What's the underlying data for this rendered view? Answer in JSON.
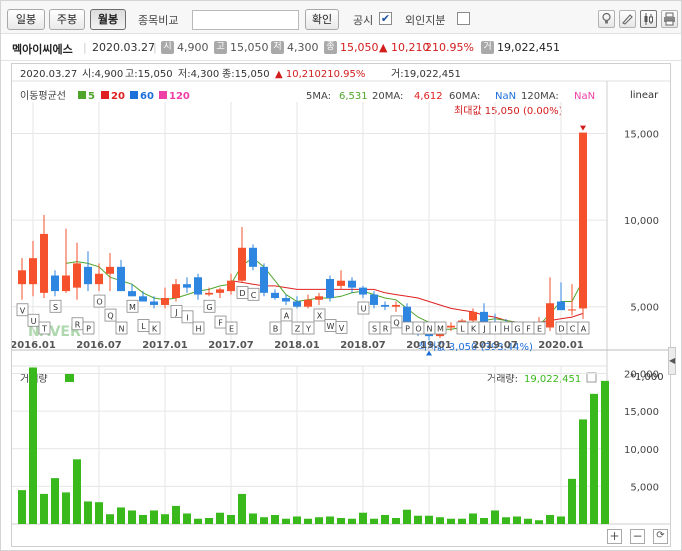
{
  "toolbar": {
    "period_buttons": [
      "일봉",
      "주봉",
      "월봉"
    ],
    "active_period": "월봉",
    "compare_label": "종목비교",
    "search_placeholder": "",
    "confirm_label": "확인",
    "disclosure_label": "공시",
    "disclosure_checked": "✔",
    "foreign_label": "외인지분",
    "icons": [
      "bulb-icon",
      "pen-icon",
      "candle-toggle-icon",
      "print-icon"
    ]
  },
  "info": {
    "name": "멕아이씨에스",
    "date": "2020.03.27",
    "open_badge": "시",
    "open": "4,900",
    "high_badge": "고",
    "high": "15,050",
    "low_badge": "저",
    "low": "4,300",
    "close_badge": "종",
    "close": "15,050",
    "change": "▲ 10,210",
    "change_pct": "210.95%",
    "volume_badge": "거",
    "volume": "19,022,451"
  },
  "chart_header": {
    "ohlc_line_date": "2020.03.27",
    "ohlc_line_open": "시:4,900",
    "ohlc_line_high": "고:15,050",
    "ohlc_line_low": "저:4,300",
    "ohlc_line_close": "종:15,050",
    "ohlc_line_change": "▲  10,210210.95%",
    "ohlc_line_volume": "거:19,022,451",
    "ma_label": "이동평균선",
    "ma_legend": [
      {
        "period": "5",
        "color": "#4fa52c"
      },
      {
        "period": "20",
        "color": "#e02020"
      },
      {
        "period": "60",
        "color": "#1e6fd9"
      },
      {
        "period": "120",
        "color": "#ee3fa7"
      }
    ],
    "ma_values": {
      "ma5_label": "5MA:",
      "ma5": "6,531",
      "ma20_label": "20MA:",
      "ma20": "4,612",
      "ma60_label": "60MA:",
      "ma60": "NaN",
      "ma120_label": "120MA:",
      "ma120": "NaN"
    },
    "scale_label": "linear",
    "max_label": "최대값 15,050 (0.00%)",
    "min_label": "최저값 3,050 (393.44%)",
    "watermark": "NAVER",
    "volume_title": "거래량",
    "volume_readout_label": "거래량:",
    "volume_readout_value": "19,022,451",
    "volume_unit": "*1,000"
  },
  "colors": {
    "up": "#f4512c",
    "down": "#2f86e0",
    "volume": "#39b91c",
    "ma5": "#4fa52c",
    "ma20": "#e02020",
    "grid": "#e6e6e6"
  },
  "chart_data": [
    {
      "type": "candlestick",
      "title": "",
      "x_tick_labels": [
        "2016.01",
        "2016.07",
        "2017.01",
        "2017.07",
        "2018.01",
        "2018.07",
        "2019.01",
        "2019.07",
        "2020.01"
      ],
      "y_tick_labels": [
        "5,000",
        "10,000",
        "15,000"
      ],
      "ylim": [
        2500,
        16700
      ],
      "grid": true,
      "period": "monthly",
      "candles": [
        {
          "month": "2015-12",
          "open": 6300,
          "high": 7800,
          "low": 5400,
          "close": 7100
        },
        {
          "month": "2016-01",
          "open": 6300,
          "high": 8800,
          "low": 5600,
          "close": 7800
        },
        {
          "month": "2016-02",
          "open": 5800,
          "high": 10300,
          "low": 5500,
          "close": 9200
        },
        {
          "month": "2016-03",
          "open": 6800,
          "high": 7100,
          "low": 5600,
          "close": 5900
        },
        {
          "month": "2016-04",
          "open": 5900,
          "high": 9500,
          "low": 5800,
          "close": 6800
        },
        {
          "month": "2016-05",
          "open": 6100,
          "high": 8700,
          "low": 5400,
          "close": 7500
        },
        {
          "month": "2016-06",
          "open": 7300,
          "high": 8200,
          "low": 5900,
          "close": 6300
        },
        {
          "month": "2016-07",
          "open": 6300,
          "high": 7500,
          "low": 5900,
          "close": 6900
        },
        {
          "month": "2016-08",
          "open": 6900,
          "high": 8100,
          "low": 5900,
          "close": 7300
        },
        {
          "month": "2016-09",
          "open": 7300,
          "high": 7700,
          "low": 5900,
          "close": 5900
        },
        {
          "month": "2016-10",
          "open": 5900,
          "high": 6300,
          "low": 5600,
          "close": 5600
        },
        {
          "month": "2016-11",
          "open": 5600,
          "high": 5900,
          "low": 5300,
          "close": 5300
        },
        {
          "month": "2016-12",
          "open": 5300,
          "high": 5600,
          "low": 4900,
          "close": 5100
        },
        {
          "month": "2017-01",
          "open": 5100,
          "high": 6100,
          "low": 4900,
          "close": 5500
        },
        {
          "month": "2017-02",
          "open": 5500,
          "high": 6600,
          "low": 5300,
          "close": 6300
        },
        {
          "month": "2017-03",
          "open": 6300,
          "high": 6700,
          "low": 5800,
          "close": 6100
        },
        {
          "month": "2017-04",
          "open": 6700,
          "high": 6900,
          "low": 5400,
          "close": 5700
        },
        {
          "month": "2017-05",
          "open": 5700,
          "high": 6100,
          "low": 5600,
          "close": 5800
        },
        {
          "month": "2017-06",
          "open": 5800,
          "high": 6100,
          "low": 5500,
          "close": 6000
        },
        {
          "month": "2017-07",
          "open": 5900,
          "high": 6900,
          "low": 5700,
          "close": 6500
        },
        {
          "month": "2017-08",
          "open": 6500,
          "high": 9600,
          "low": 6400,
          "close": 8400
        },
        {
          "month": "2017-09",
          "open": 8400,
          "high": 8600,
          "low": 7100,
          "close": 7300
        },
        {
          "month": "2017-10",
          "open": 7300,
          "high": 7500,
          "low": 5600,
          "close": 5800
        },
        {
          "month": "2017-11",
          "open": 5800,
          "high": 6000,
          "low": 5400,
          "close": 5500
        },
        {
          "month": "2017-12",
          "open": 5500,
          "high": 5700,
          "low": 5100,
          "close": 5300
        },
        {
          "month": "2018-01",
          "open": 5300,
          "high": 5600,
          "low": 4900,
          "close": 5000
        },
        {
          "month": "2018-02",
          "open": 5000,
          "high": 5700,
          "low": 4900,
          "close": 5400
        },
        {
          "month": "2018-03",
          "open": 5400,
          "high": 5800,
          "low": 5100,
          "close": 5600
        },
        {
          "month": "2018-04",
          "open": 6600,
          "high": 6800,
          "low": 5300,
          "close": 5500
        },
        {
          "month": "2018-05",
          "open": 6200,
          "high": 7100,
          "low": 6000,
          "close": 6500
        },
        {
          "month": "2018-06",
          "open": 6500,
          "high": 6700,
          "low": 5800,
          "close": 6100
        },
        {
          "month": "2018-07",
          "open": 6100,
          "high": 6200,
          "low": 5500,
          "close": 5700
        },
        {
          "month": "2018-08",
          "open": 5700,
          "high": 5900,
          "low": 4900,
          "close": 5100
        },
        {
          "month": "2018-09",
          "open": 5100,
          "high": 5300,
          "low": 4800,
          "close": 5000
        },
        {
          "month": "2018-10",
          "open": 5000,
          "high": 5300,
          "low": 4700,
          "close": 5100
        },
        {
          "month": "2018-11",
          "open": 5000,
          "high": 5200,
          "low": 3400,
          "close": 3700
        },
        {
          "month": "2018-12",
          "open": 3700,
          "high": 3900,
          "low": 3300,
          "close": 3500
        },
        {
          "month": "2019-01",
          "open": 3600,
          "high": 3800,
          "low": 3050,
          "close": 3300
        },
        {
          "month": "2019-02",
          "open": 3300,
          "high": 3900,
          "low": 3200,
          "close": 3800
        },
        {
          "month": "2019-03",
          "open": 3800,
          "high": 4100,
          "low": 3600,
          "close": 3900
        },
        {
          "month": "2019-04",
          "open": 3900,
          "high": 4300,
          "low": 3800,
          "close": 4200
        },
        {
          "month": "2019-05",
          "open": 4200,
          "high": 4900,
          "low": 4000,
          "close": 4700
        },
        {
          "month": "2019-06",
          "open": 4700,
          "high": 5200,
          "low": 4000,
          "close": 4100
        },
        {
          "month": "2019-07",
          "open": 4100,
          "high": 4600,
          "low": 3700,
          "close": 3900
        },
        {
          "month": "2019-08",
          "open": 3900,
          "high": 4300,
          "low": 3500,
          "close": 3700
        },
        {
          "month": "2019-09",
          "open": 3700,
          "high": 3900,
          "low": 3500,
          "close": 3600
        },
        {
          "month": "2019-10",
          "open": 3600,
          "high": 3800,
          "low": 3400,
          "close": 3700
        },
        {
          "month": "2019-11",
          "open": 3700,
          "high": 4400,
          "low": 3500,
          "close": 3800
        },
        {
          "month": "2019-12",
          "open": 3800,
          "high": 6700,
          "low": 3600,
          "close": 5200
        },
        {
          "month": "2020-01",
          "open": 5300,
          "high": 6400,
          "low": 4900,
          "close": 4800
        },
        {
          "month": "2020-02",
          "open": 4800,
          "high": 6300,
          "low": 4500,
          "close": 4840
        },
        {
          "month": "2020-03",
          "open": 4900,
          "high": 15050,
          "low": 4300,
          "close": 15050
        }
      ],
      "ma5": [
        null,
        null,
        null,
        null,
        7500,
        7600,
        7500,
        7300,
        6700,
        6500,
        6300,
        5800,
        5500,
        5400,
        5500,
        5700,
        5900,
        6000,
        6200,
        6300,
        7400,
        7800,
        7300,
        6500,
        5700,
        5300,
        5400,
        5500,
        5500,
        5600,
        5800,
        5900,
        5700,
        5500,
        5400,
        4900,
        4400,
        4100,
        3700,
        3700,
        3800,
        4000,
        4200,
        4300,
        4200,
        4100,
        3800,
        3900,
        4600,
        5300,
        5300,
        6531
      ],
      "ma20": [
        null,
        null,
        null,
        null,
        null,
        null,
        null,
        null,
        null,
        null,
        null,
        null,
        null,
        null,
        null,
        null,
        null,
        null,
        null,
        6500,
        6400,
        6300,
        6200,
        6200,
        6100,
        6000,
        6000,
        6000,
        6000,
        6000,
        6000,
        6000,
        6000,
        5800,
        5700,
        5600,
        5500,
        5300,
        5100,
        4900,
        4800,
        4700,
        4500,
        4400,
        4200,
        4100,
        4000,
        4100,
        4200,
        4300,
        4400,
        4612
      ]
    },
    {
      "type": "bar",
      "title": "",
      "unit": "*1,000",
      "y_tick_labels": [
        "5,000",
        "10,000",
        "15,000",
        "20,000"
      ],
      "ylim": [
        0,
        21000
      ],
      "values": [
        4500,
        20800,
        4000,
        6100,
        4200,
        8600,
        3000,
        2900,
        1300,
        2200,
        1800,
        1200,
        1800,
        1300,
        2400,
        1400,
        700,
        800,
        1500,
        1200,
        4000,
        1400,
        900,
        1200,
        700,
        1000,
        700,
        900,
        1000,
        800,
        700,
        1500,
        700,
        1200,
        800,
        1900,
        1100,
        1100,
        900,
        700,
        700,
        1400,
        800,
        1800,
        900,
        1000,
        700,
        500,
        1200,
        1000,
        6000,
        13900,
        17300,
        19022
      ]
    }
  ],
  "event_markers": [
    "V",
    "U",
    "T",
    "S",
    "R",
    "P",
    "O",
    "Q",
    "N",
    "M",
    "L",
    "K",
    "J",
    "I",
    "H",
    "G",
    "F",
    "E",
    "D",
    "C",
    "B",
    "A",
    "Z",
    "Y",
    "X",
    "W",
    "V",
    "U",
    "S",
    "R",
    "Q",
    "P",
    "O",
    "N",
    "M",
    "L",
    "K",
    "J",
    "I",
    "H",
    "G",
    "F",
    "E",
    "D",
    "C",
    "A"
  ]
}
